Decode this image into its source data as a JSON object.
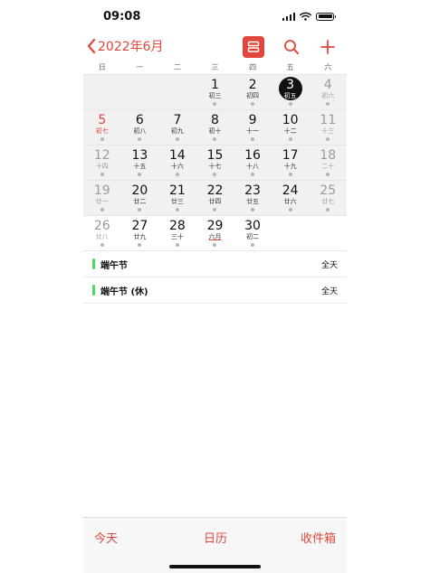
{
  "status": {
    "time": "09:08"
  },
  "nav": {
    "back_label": "2022年6月",
    "accent": "#e0473b"
  },
  "weekdays": [
    "日",
    "一",
    "二",
    "三",
    "四",
    "五",
    "六"
  ],
  "weeks": [
    [
      null,
      null,
      null,
      {
        "n": "1",
        "l": "初三"
      },
      {
        "n": "2",
        "l": "初四"
      },
      {
        "n": "3",
        "l": "初五",
        "today": true
      },
      {
        "n": "4",
        "l": "初六",
        "dim": true
      }
    ],
    [
      {
        "n": "5",
        "l": "初七",
        "red": true
      },
      {
        "n": "6",
        "l": "初八"
      },
      {
        "n": "7",
        "l": "初九"
      },
      {
        "n": "8",
        "l": "初十"
      },
      {
        "n": "9",
        "l": "十一"
      },
      {
        "n": "10",
        "l": "十二"
      },
      {
        "n": "11",
        "l": "十三",
        "dim": true
      }
    ],
    [
      {
        "n": "12",
        "l": "十四",
        "dim": true
      },
      {
        "n": "13",
        "l": "十五"
      },
      {
        "n": "14",
        "l": "十六"
      },
      {
        "n": "15",
        "l": "十七"
      },
      {
        "n": "16",
        "l": "十八"
      },
      {
        "n": "17",
        "l": "十九"
      },
      {
        "n": "18",
        "l": "二十",
        "dim": true
      }
    ],
    [
      {
        "n": "19",
        "l": "廿一",
        "dim": true
      },
      {
        "n": "20",
        "l": "廿二"
      },
      {
        "n": "21",
        "l": "廿三"
      },
      {
        "n": "22",
        "l": "廿四"
      },
      {
        "n": "23",
        "l": "廿五"
      },
      {
        "n": "24",
        "l": "廿六"
      },
      {
        "n": "25",
        "l": "廿七",
        "dim": true
      }
    ],
    [
      {
        "n": "26",
        "l": "廿八",
        "dim": true
      },
      {
        "n": "27",
        "l": "廿九"
      },
      {
        "n": "28",
        "l": "三十"
      },
      {
        "n": "29",
        "l": "六月",
        "month_start": true
      },
      {
        "n": "30",
        "l": "初二"
      },
      null,
      null
    ]
  ],
  "events": [
    {
      "title": "端午节",
      "time": "全天",
      "color": "#4cd964"
    },
    {
      "title": "端午节 (休)",
      "time": "全天",
      "color": "#4cd964"
    }
  ],
  "tabs": {
    "today": "今天",
    "calendar": "日历",
    "inbox": "收件箱"
  }
}
